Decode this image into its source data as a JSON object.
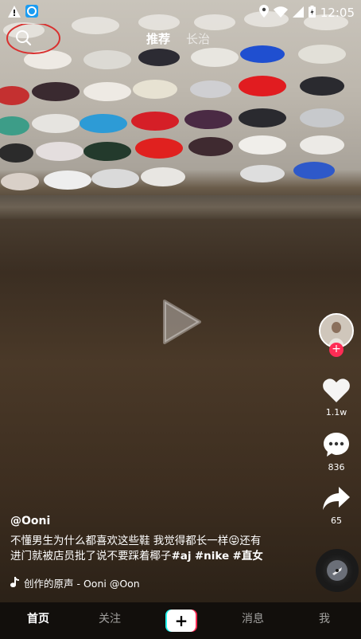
{
  "status_bar": {
    "time": "12:05"
  },
  "header": {
    "tab_recommend": "推荐",
    "tab_local": "长治"
  },
  "side_actions": {
    "likes": "1.1w",
    "comments": "836",
    "shares": "65"
  },
  "caption": {
    "author": "@Ooni",
    "line1": "不懂男生为什么都喜欢这些鞋 我觉得都长一样😝还有",
    "line2_prefix": "进门就被店员批了说不要踩着椰子",
    "hashtags": [
      "#aj",
      "#nike",
      "#直女"
    ]
  },
  "music": {
    "text": "创作的原声 - Ooni    @Oon"
  },
  "bottom_nav": {
    "home": "首页",
    "follow": "关注",
    "add": "+",
    "messages": "消息",
    "me": "我"
  },
  "colors": {
    "accent_red": "#fe2c55",
    "accent_cyan": "#25f4ee",
    "annotation_circle": "#d9302f"
  }
}
